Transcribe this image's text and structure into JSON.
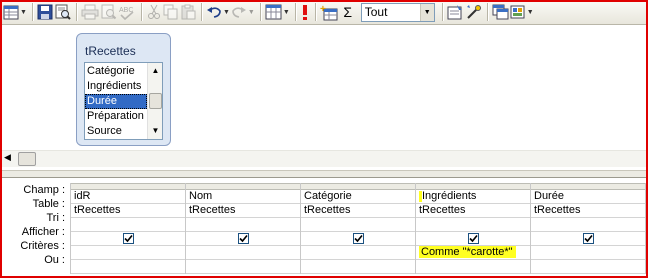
{
  "toolbar": {
    "buttons": [
      {
        "name": "view-icon",
        "title": "Affichage"
      },
      {
        "name": "save-icon",
        "title": "Enregistrer"
      },
      {
        "name": "print-preview-icon",
        "title": "Aperçu"
      },
      {
        "name": "print-icon",
        "title": "Imprimer"
      },
      {
        "name": "preview-icon",
        "title": "Aperçu avant impression"
      },
      {
        "name": "spelling-icon",
        "title": "Orthographe"
      },
      {
        "name": "cut-icon",
        "title": "Couper"
      },
      {
        "name": "copy-icon",
        "title": "Copier"
      },
      {
        "name": "paste-icon",
        "title": "Coller"
      },
      {
        "name": "undo-icon",
        "title": "Annuler"
      },
      {
        "name": "redo-icon",
        "title": "Rétablir"
      },
      {
        "name": "query-type-icon",
        "title": "Type de requête"
      },
      {
        "name": "run-icon",
        "title": "Exécuter"
      },
      {
        "name": "show-table-icon",
        "title": "Afficher la table"
      },
      {
        "name": "totals-icon",
        "title": "Opérations"
      },
      {
        "name": "properties-icon",
        "title": "Propriétés"
      },
      {
        "name": "build-icon",
        "title": "Générer"
      },
      {
        "name": "database-window-icon",
        "title": "Fenêtre Base de données"
      },
      {
        "name": "new-object-icon",
        "title": "Nouvel objet"
      }
    ],
    "totals_symbol": "Σ",
    "top_values": "Tout"
  },
  "table": {
    "title": "tRecettes",
    "fields": [
      "Catégorie",
      "Ingrédients",
      "Durée",
      "Préparation",
      "Source"
    ],
    "selected_field": "Durée"
  },
  "grid": {
    "row_labels": [
      "Champ :",
      "Table :",
      "Tri :",
      "Afficher :",
      "Critères :",
      "Ou :"
    ],
    "columns": [
      {
        "champ": "idR",
        "table": "tRecettes",
        "tri": "",
        "afficher": true,
        "criteres": "",
        "ou": ""
      },
      {
        "champ": "Nom",
        "table": "tRecettes",
        "tri": "",
        "afficher": true,
        "criteres": "",
        "ou": ""
      },
      {
        "champ": "Catégorie",
        "table": "tRecettes",
        "tri": "",
        "afficher": true,
        "criteres": "",
        "ou": ""
      },
      {
        "champ": "Ingrédients",
        "table": "tRecettes",
        "tri": "",
        "afficher": true,
        "criteres": "Comme \"*carotte*\"",
        "ou": ""
      },
      {
        "champ": "Durée",
        "table": "tRecettes",
        "tri": "",
        "afficher": true,
        "criteres": "",
        "ou": ""
      }
    ],
    "highlight_color": "#ffff22"
  }
}
